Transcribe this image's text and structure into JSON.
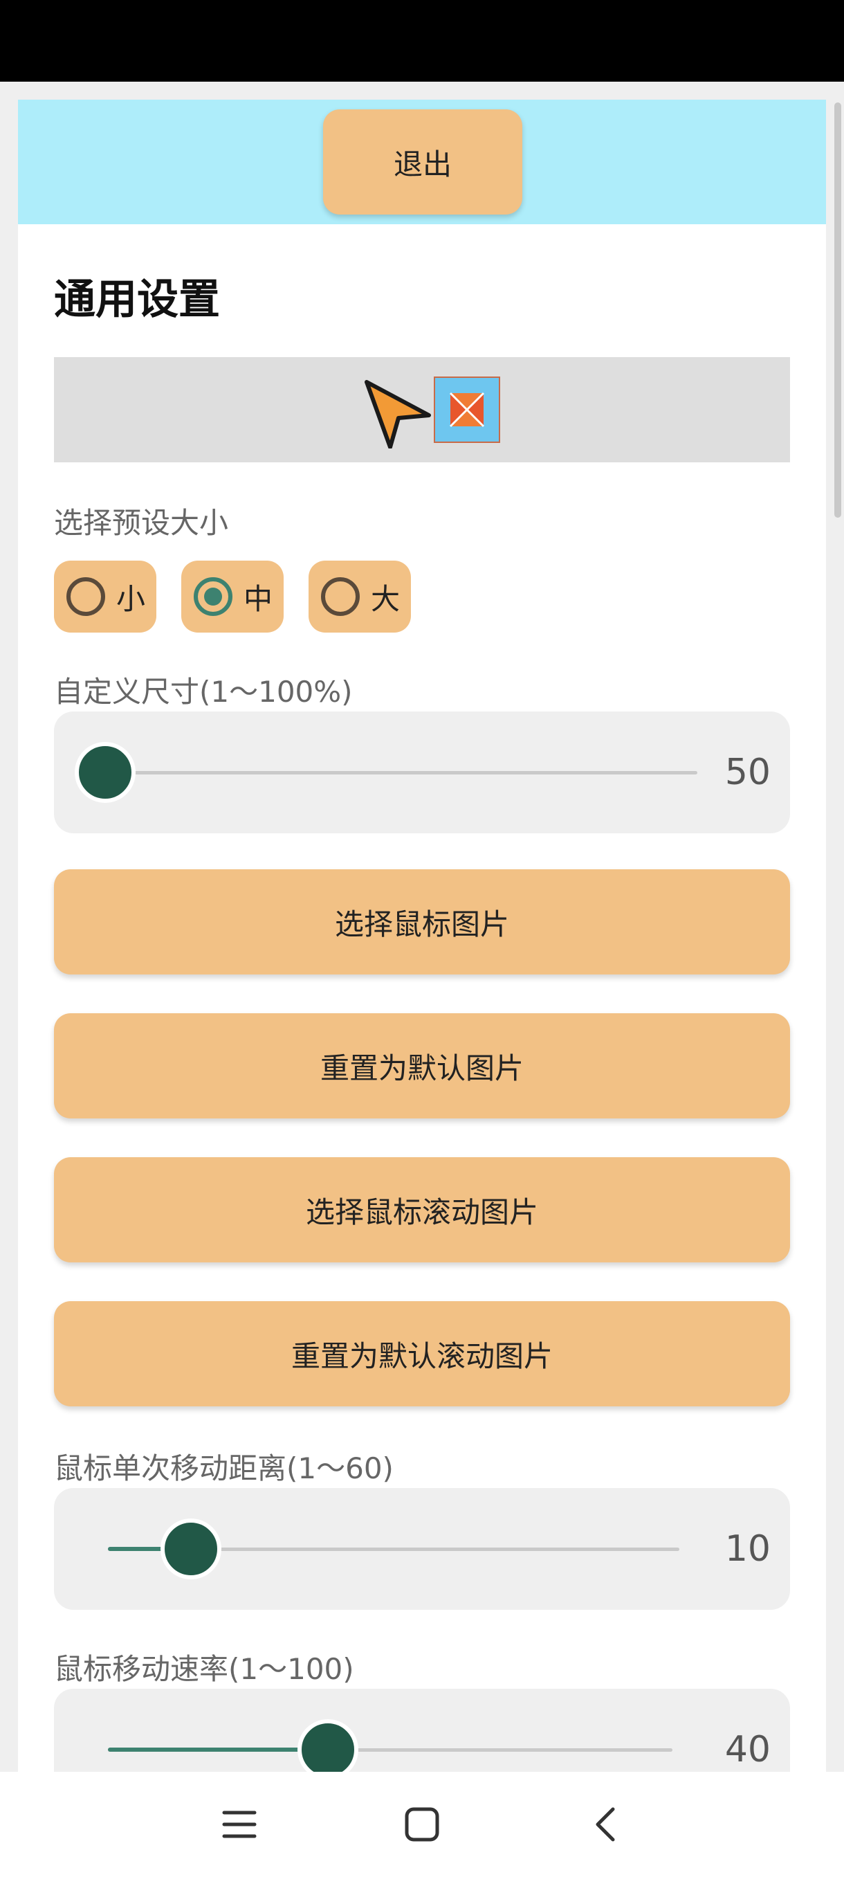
{
  "header": {
    "exit_label": "退出"
  },
  "page": {
    "title": "通用设置"
  },
  "preset_size": {
    "label": "选择预设大小",
    "options": [
      {
        "label": "小",
        "selected": false
      },
      {
        "label": "中",
        "selected": true
      },
      {
        "label": "大",
        "selected": false
      }
    ]
  },
  "custom_size": {
    "label": "自定义尺寸(1～100%)",
    "value": "50",
    "min": 1,
    "max": 100
  },
  "buttons": {
    "choose_cursor": "选择鼠标图片",
    "reset_cursor": "重置为默认图片",
    "choose_scroll": "选择鼠标滚动图片",
    "reset_scroll": "重置为默认滚动图片"
  },
  "move_distance": {
    "label": "鼠标单次移动距离(1～60)",
    "value": "10",
    "min": 1,
    "max": 60
  },
  "move_speed": {
    "label": "鼠标移动速率(1～100)",
    "value": "40",
    "min": 1,
    "max": 100
  },
  "colors": {
    "accent": "#3d8270",
    "thumb": "#215847",
    "button": "#f2c185",
    "banner": "#aeedfa"
  },
  "icons": {
    "cursor_preview": "orange-arrow-cursor-icon",
    "scroll_preview": "scroll-cursor-icon",
    "nav_menu": "menu-lines-icon",
    "nav_home": "square-home-icon",
    "nav_back": "chevron-left-icon"
  }
}
